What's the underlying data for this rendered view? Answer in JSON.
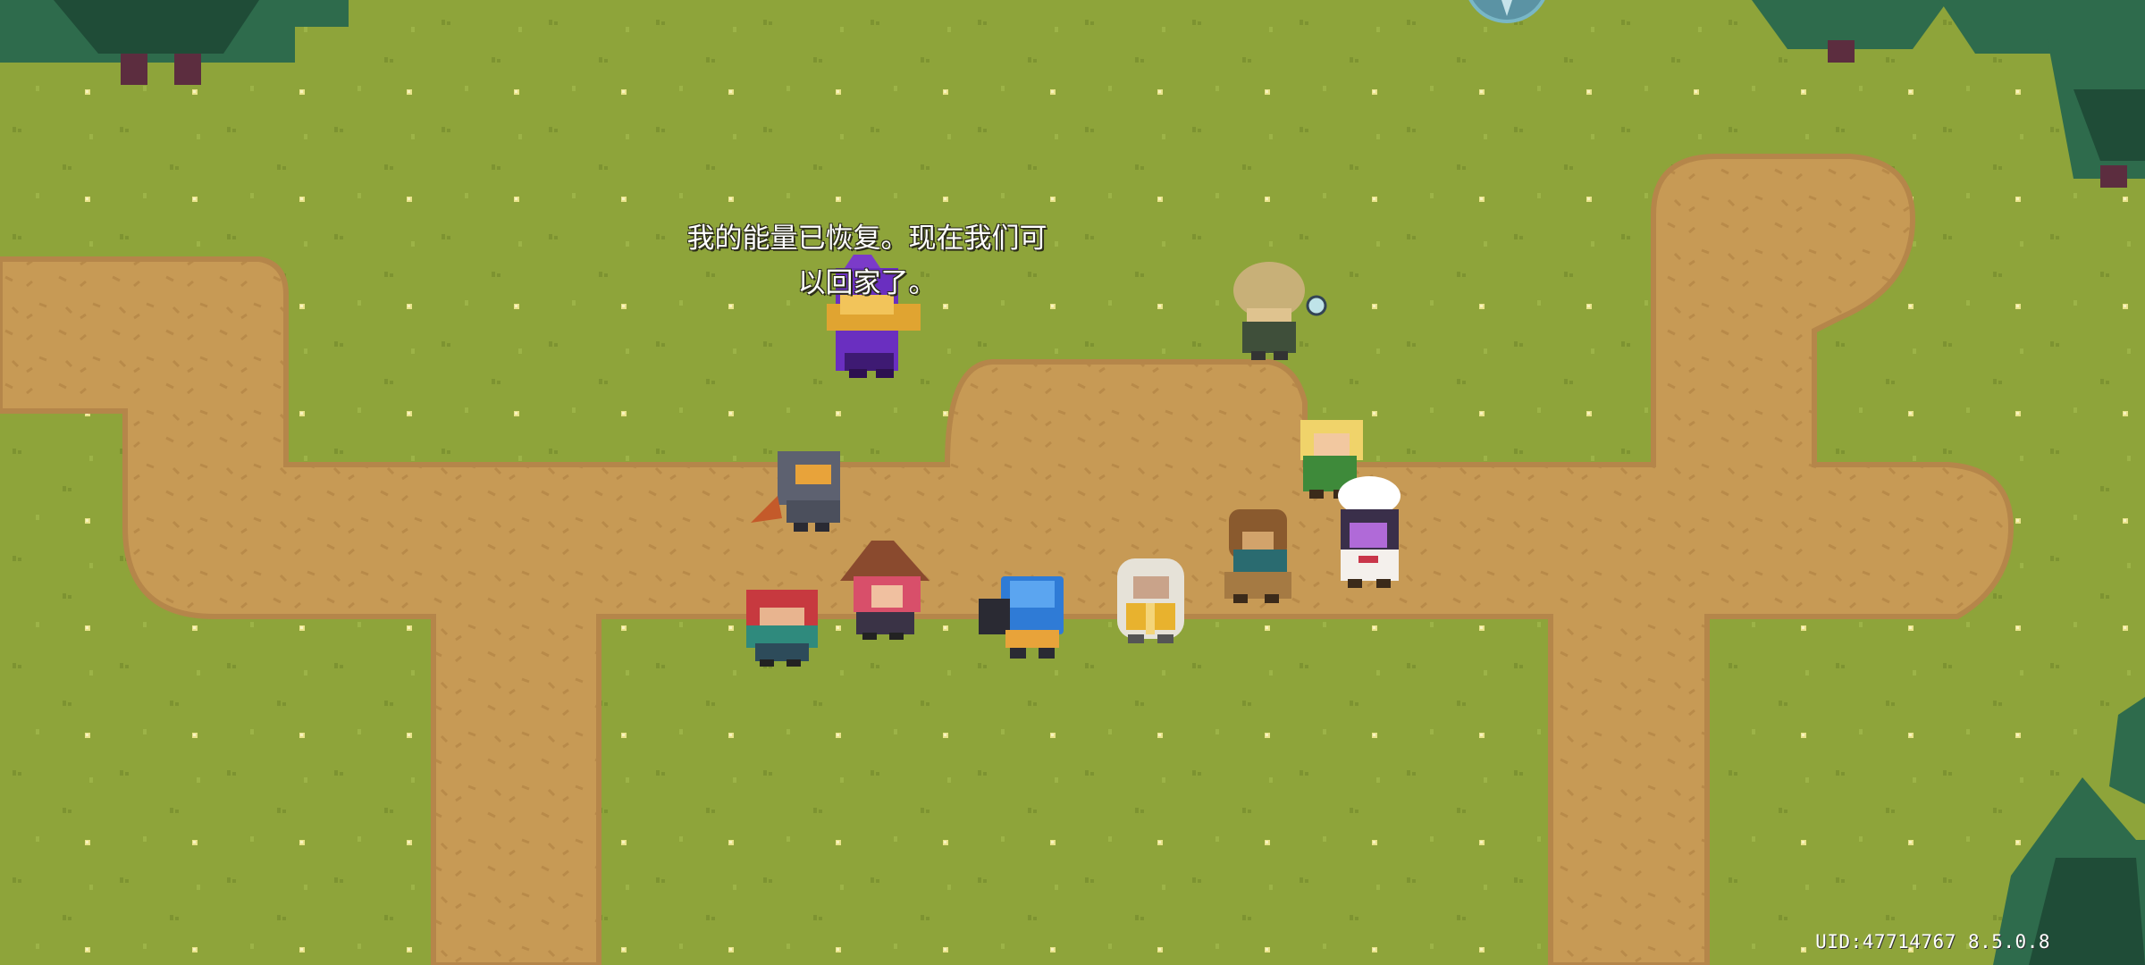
{
  "dialogue": {
    "text": "我的能量已恢复。现在我们可\n以回家了。"
  },
  "footer": {
    "uid_version": "UID:47714767 8.5.0.8"
  },
  "scene": {
    "colors": {
      "grass": "#8ea43a",
      "path": "#c79a55",
      "path_edge": "#b5864a",
      "tree": "#2e6b4c",
      "tree_dark": "#1f4c37",
      "trunk": "#5c2d3f"
    },
    "characters": [
      "purple-mage-speaking",
      "knight-hero",
      "red-haired-rogue",
      "witch",
      "blue-robot-gunner",
      "white-priest",
      "explorer-with-pith-helmet",
      "blonde-elf",
      "bear-warrior",
      "chef"
    ]
  }
}
